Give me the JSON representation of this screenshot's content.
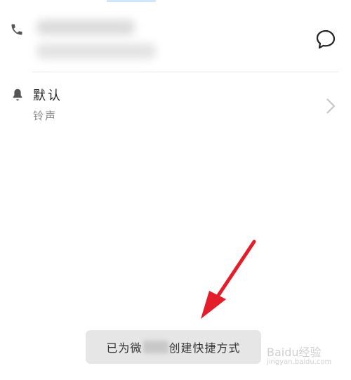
{
  "ringtone": {
    "value": "默认",
    "label": "铃声"
  },
  "toast": {
    "prefix": "已为",
    "prefix_char": "微",
    "suffix": "创建快捷方式"
  },
  "watermark": {
    "brand": "Baidu经验",
    "url": "jingyan.baidu.com"
  },
  "colors": {
    "annotation_arrow": "#e31d2a",
    "toast_bg": "#e6e6e6",
    "secondary_text": "#8a8a8a"
  },
  "icons": [
    "phone-icon",
    "message-icon",
    "bell-icon",
    "chevron-right-icon"
  ]
}
